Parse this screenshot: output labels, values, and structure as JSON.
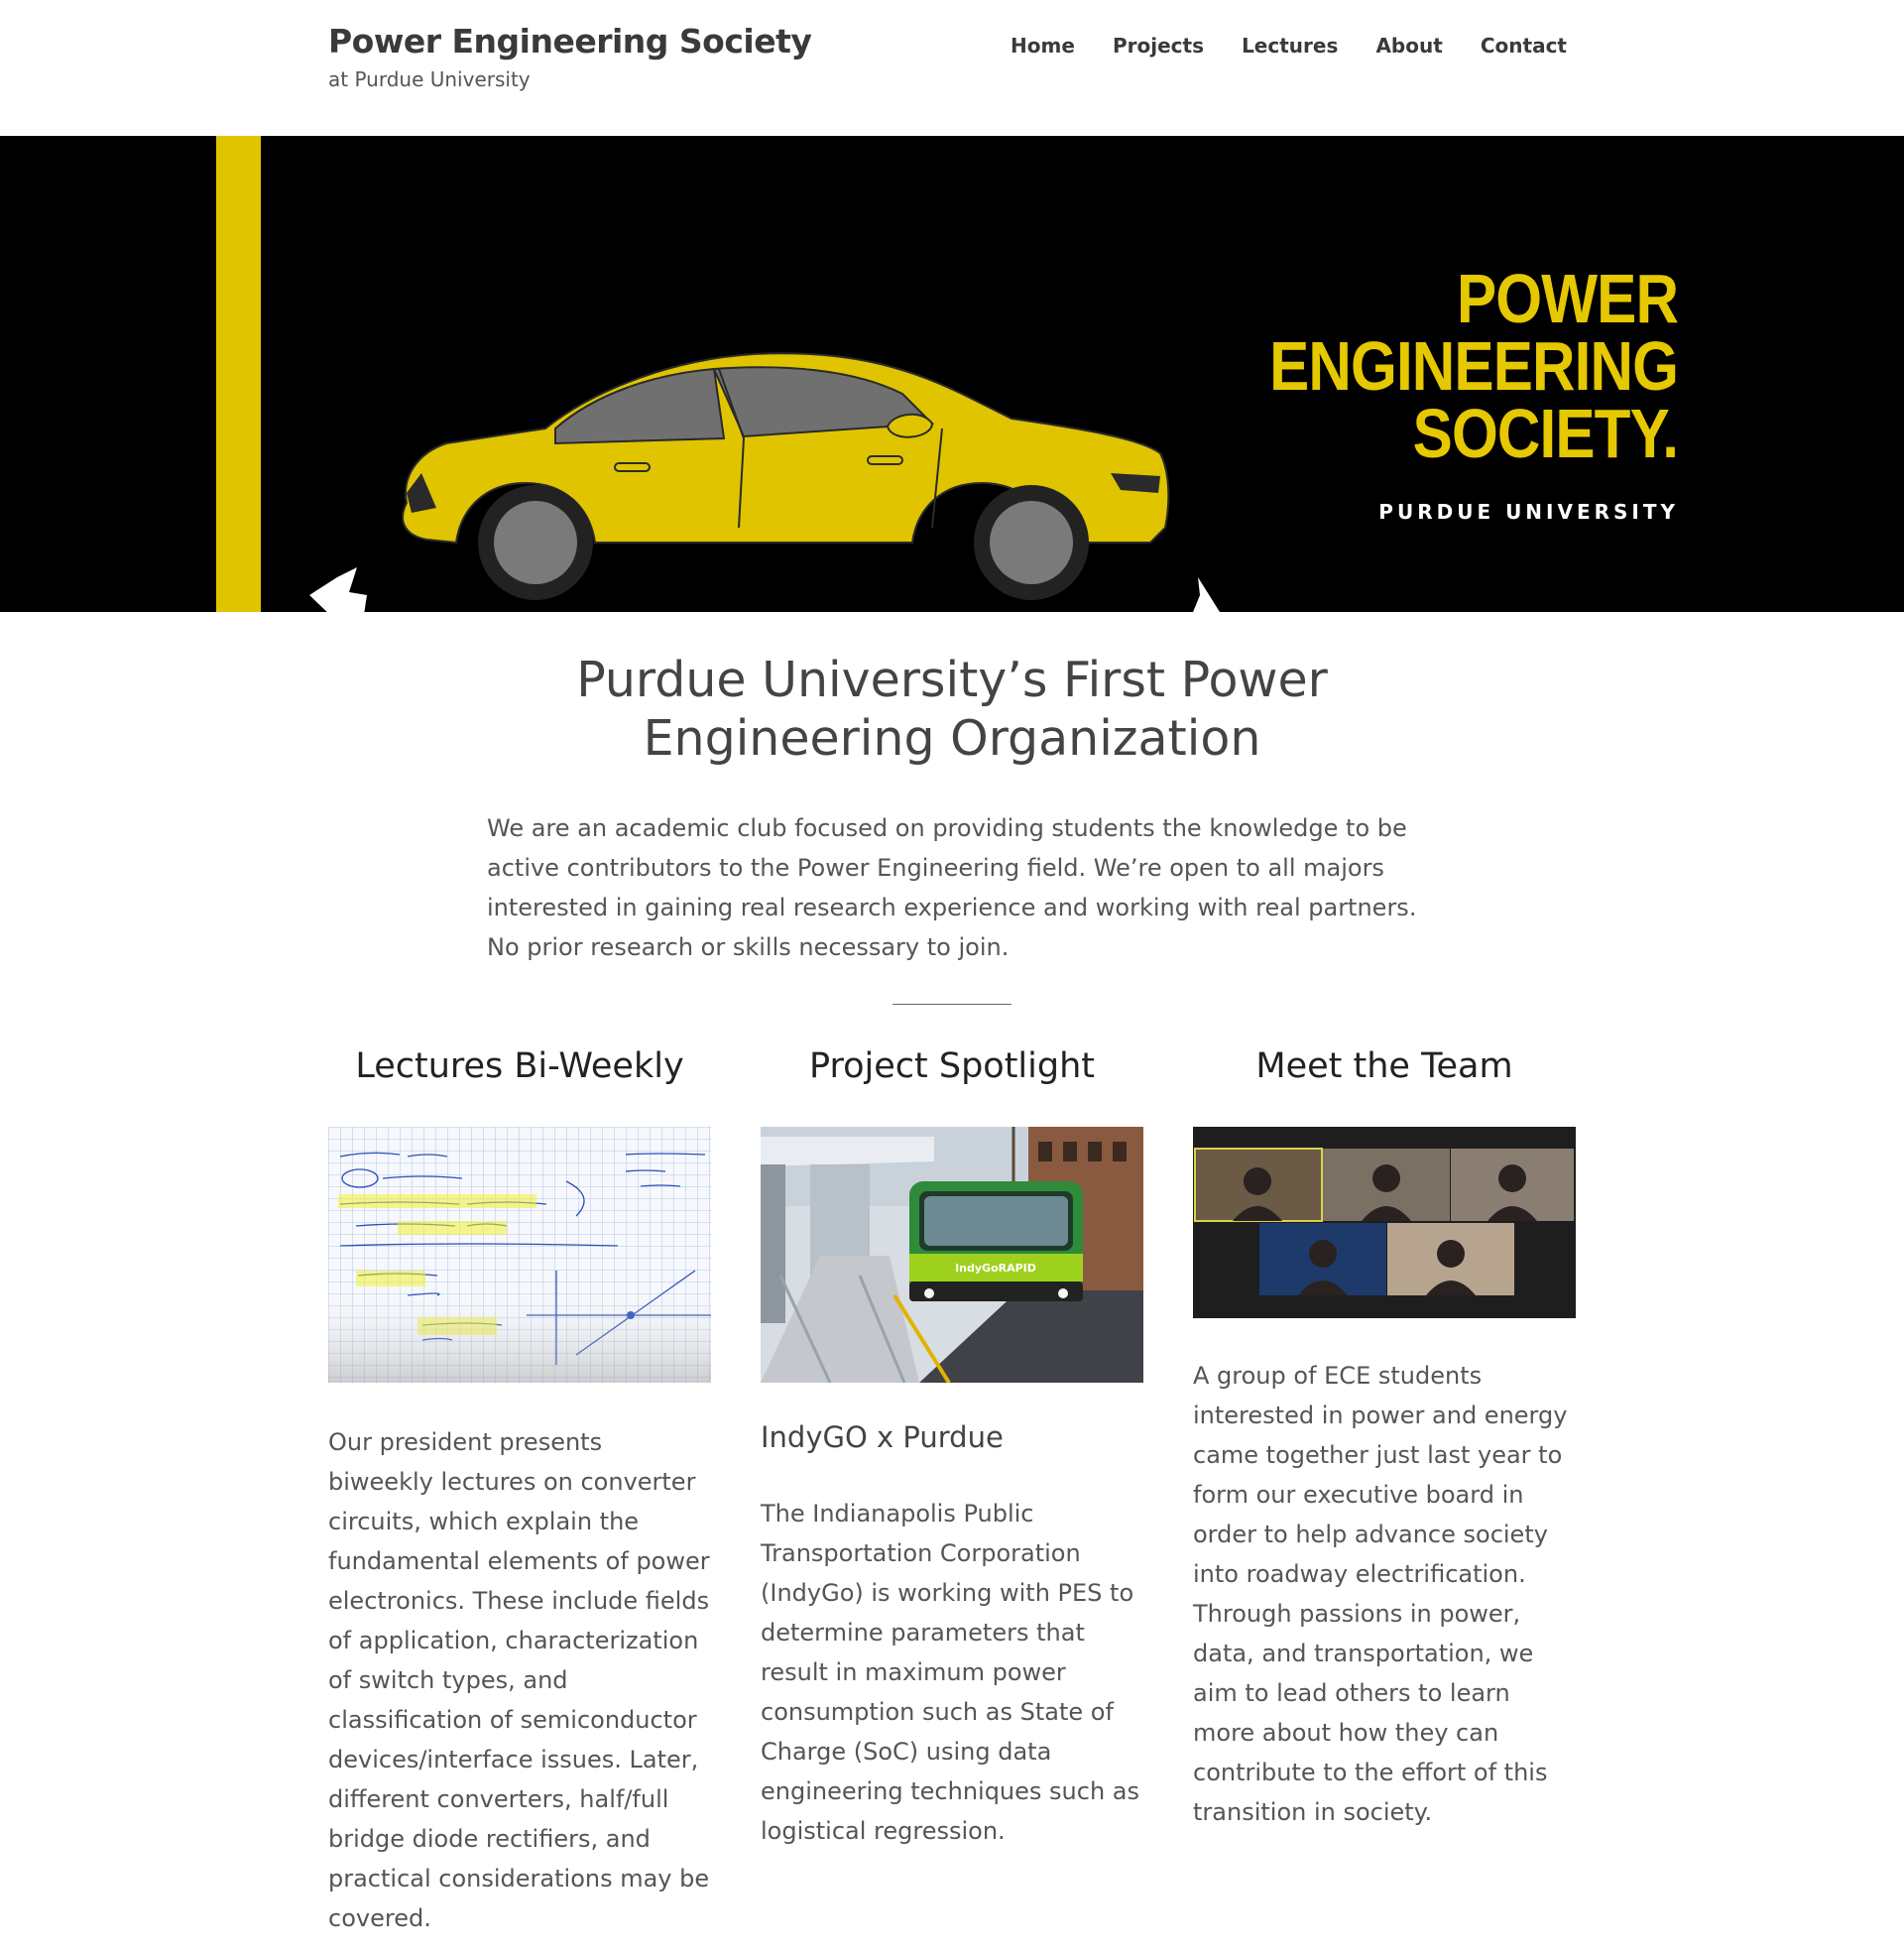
{
  "header": {
    "site_title": "Power Engineering Society",
    "tagline": "at Purdue University",
    "nav": [
      "Home",
      "Projects",
      "Lectures",
      "About",
      "Contact"
    ]
  },
  "hero": {
    "title_lines": [
      "POWER",
      "ENGINEERING",
      "SOCIETY."
    ],
    "subtitle": "PURDUE UNIVERSITY",
    "colors": {
      "yellow": "#e0c400",
      "background": "#000000"
    }
  },
  "intro": {
    "heading": "Purdue University’s First Power Engineering Organization",
    "text": "We are an academic club focused on providing students the knowledge to be active contributors to the Power Engineering field. We’re open to all majors interested in gaining real research experience and working with real partners. No prior research or skills necessary to join."
  },
  "columns": [
    {
      "title": "Lectures Bi-Weekly",
      "image": "handwritten-notes-image",
      "text": "Our president presents biweekly lectures on converter circuits, which explain the fundamental elements of power electronics. These include fields of application, characterization of switch types, and classification of semiconductor devices/interface issues. Later, different converters, half/full bridge diode rectifiers, and practical considerations may be covered."
    },
    {
      "title": "Project Spotlight",
      "image": "indygo-bus-image",
      "bus_label": "IndyGoRAPID",
      "subtitle": "IndyGO x Purdue",
      "text": "The Indianapolis Public Transportation Corporation (IndyGo) is working with PES to determine parameters that result in maximum power consumption such as State of Charge (SoC) using data engineering techniques such as logistical regression."
    },
    {
      "title": "Meet the Team",
      "image": "team-video-call-image",
      "text": "A group of ECE students interested in power and energy came together just last year to form our executive board in order to help advance society into roadway electrification. Through passions in power, data, and transportation, we aim to lead others to learn more about how they can contribute to the effort of this transition in society."
    }
  ]
}
